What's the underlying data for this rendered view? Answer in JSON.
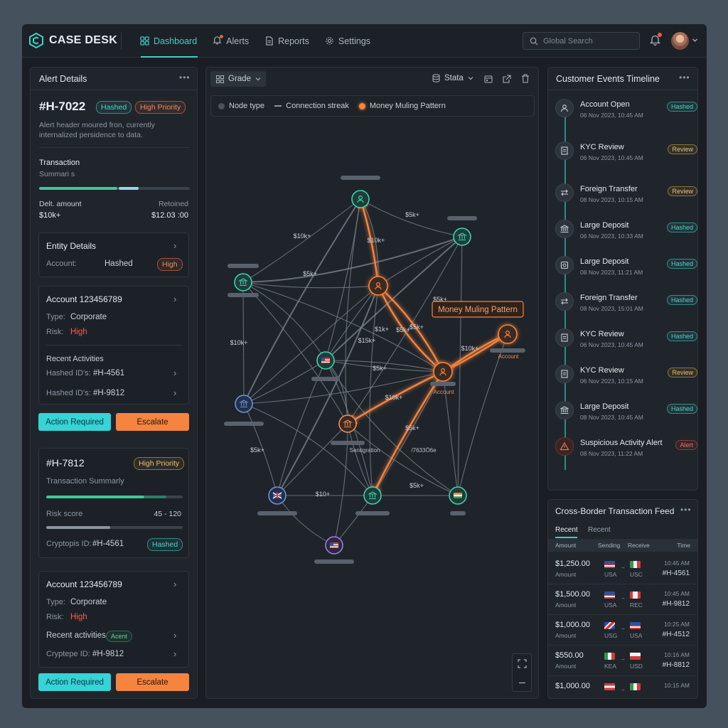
{
  "app": {
    "name": "CASE DESK"
  },
  "nav": {
    "items": [
      "Dashboard",
      "Alerts",
      "Reports",
      "Settings"
    ],
    "active": "Dashboard"
  },
  "search": {
    "placeholder": "Global Search"
  },
  "alert_panel": {
    "title": "Alert Details",
    "alert_id": "#H-7022",
    "status_badge": "Hashed",
    "priority_badge": "High Priority",
    "description": "Alert header moured fron, currently internalized persidence to data.",
    "transaction_label": "Transaction",
    "summary_label": "Summari s",
    "progress_primary": 0.52,
    "progress_secondary": 0.13,
    "delta_label": "Delt. amount",
    "delta_value": "$10k+",
    "retained_label": "Retoined",
    "retained_value": "$12.03 :00",
    "entity": {
      "title": "Entity Details",
      "account_label": "Account:",
      "account_value": "Hashed",
      "risk_badge": "High"
    },
    "account1": {
      "title": "Account 123456789",
      "type_label": "Type:",
      "type_value": "Corporate",
      "risk_label": "Risk:",
      "risk_value": "High",
      "recent_label": "Recent Activities",
      "rows": [
        {
          "label": "Hashed ID's:",
          "value": "#H-4561"
        },
        {
          "label": "Hashed ID's:",
          "value": "#H-9812"
        }
      ]
    },
    "action_required": "Action Required",
    "escalate": "Escalate"
  },
  "alert2": {
    "id": "#H-7812",
    "priority_badge": "High Priority",
    "summary": "Transaction Summarly",
    "progress": 0.88,
    "progress_secondary": 0.16,
    "risk_label": "Risk score",
    "risk_value": "45 - 120",
    "risk_progress": 0.47,
    "crypto_label": "Cryptopis ID:",
    "crypto_value": "#H-4561",
    "crypto_badge": "Hashed"
  },
  "account2": {
    "title": "Account 123456789",
    "type_label": "Type:",
    "type_value": "Corporate",
    "risk_label": "Risk:",
    "risk_value": "High",
    "recent_label": "Recent activities",
    "recent_badge": "Acent",
    "crypto_label": "Cryptepe ID:",
    "crypto_value": "#H-9812",
    "action_required": "Action Required",
    "escalate": "Escalate"
  },
  "graph": {
    "toolbar": {
      "view": "Grade",
      "data": "Stata"
    },
    "legend": [
      "Node type",
      "Connection streak",
      "Money Muling Pattern"
    ],
    "pattern_label": "Money Muling Pattern",
    "edge_labels": [
      "$10k+",
      "$5k+",
      "$10k+",
      "$5k+",
      "$5k+",
      "$10k+",
      "$15k+",
      "$5k+",
      "$1k+",
      "$5k+",
      "$10k+",
      "$5k+",
      "$10k+",
      "$5k+",
      "$5k+",
      "$10+",
      "$5k+"
    ],
    "node_labels": [
      "Account",
      "Account",
      "Sentigration",
      "/7633Ö6e"
    ],
    "colors": {
      "pattern": "#f5843f",
      "node": "#3fd0a8",
      "edge": "#8c96a0"
    }
  },
  "timeline": {
    "title": "Customer Events Timeline",
    "events": [
      {
        "title": "Account Open",
        "date": "06 Nov 2023, 10:45 AM",
        "badge": "Hashed",
        "kind": "teal",
        "icon": "user-icon"
      },
      {
        "title": "KYC Review",
        "date": "06 Nov 2023, 10:45 AM",
        "badge": "Review",
        "kind": "yellow",
        "icon": "document-icon"
      },
      {
        "title": "Foreign Transfer",
        "date": "08 Nov 2023, 10:15 AM",
        "badge": "Review",
        "kind": "yellow",
        "icon": "transfer-icon"
      },
      {
        "title": "Large Deposit",
        "date": "06 Nov 2023, 10:33 AM",
        "badge": "Hashed",
        "kind": "teal",
        "icon": "bank-icon"
      },
      {
        "title": "Large Deposit",
        "date": "08 Nov 2023, 11:21 AM",
        "badge": "Hashed",
        "kind": "teal",
        "icon": "deposit-icon"
      },
      {
        "title": "Foreign Transfer",
        "date": "08 Nov 2023, 15:01 AM",
        "badge": "Hashed",
        "kind": "teal",
        "icon": "transfer-icon"
      },
      {
        "title": "KYC Review",
        "date": "06 Nov 2023, 10:45 AM",
        "badge": "Hashed",
        "kind": "teal",
        "icon": "document-icon"
      },
      {
        "title": "KYC Review",
        "date": "06 Nov 2023, 10:15 AM",
        "badge": "Review",
        "kind": "yellow",
        "icon": "document-icon"
      },
      {
        "title": "Large Deposit",
        "date": "08 Nov 2023, 10:45 AM",
        "badge": "Hashed",
        "kind": "teal",
        "icon": "bank-icon"
      },
      {
        "title": "Suspicious Activity Alert",
        "date": "08 Nov 2023, 11:22 AM",
        "badge": "Alert",
        "kind": "red",
        "icon": "warning-icon"
      }
    ]
  },
  "feed": {
    "title": "Cross-Border Transaction Feed",
    "tabs": [
      "Recent",
      "Recent"
    ],
    "columns": [
      "Amount",
      "Sending",
      "Receive",
      "Time"
    ],
    "rows": [
      {
        "amount": "$1,250.00",
        "sub": "Amount",
        "from": "USA",
        "to": "USC",
        "time": "10:45 AM",
        "id": "#H-4561"
      },
      {
        "amount": "$1,500.00",
        "sub": "Amount",
        "from": "USA",
        "to": "REC",
        "time": "10:45 AM",
        "id": "#H-9812"
      },
      {
        "amount": "$1,000.00",
        "sub": "Amount",
        "from": "USG",
        "to": "USA",
        "time": "10:25 AM",
        "id": "#H-4512"
      },
      {
        "amount": "$550.00",
        "sub": "Amount",
        "from": "KEA",
        "to": "USD",
        "time": "10:16 AM",
        "id": "#H-8812"
      },
      {
        "amount": "$1,000.00",
        "sub": "",
        "from": "",
        "to": "",
        "time": "10:15 AM",
        "id": ""
      }
    ]
  }
}
